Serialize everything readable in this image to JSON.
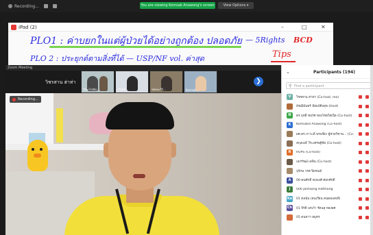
{
  "topbar": {
    "recording_label": "Recording...",
    "share_banner": "You are viewing Komsak Anawong's screen",
    "view_options": "View Options ▾"
  },
  "shared_window": {
    "title": "iPad (2)",
    "handwriting": {
      "line1": "PLO1 : ค่าบยกในแต่ผู้ป่วยได้อย่างถูกต้อง ปลอดภัย",
      "line1_right": "— 5Rights",
      "bcd": "BCD",
      "line2": "PLO 2 : ประยุกต์ตามสิ่งที่ได้ — USP/NF vol. ค่าสุด",
      "tips": "Tips"
    }
  },
  "meeting": {
    "window_title": "Zoom Meeting",
    "self_name": "วิชรสาน ฮ่าท่า",
    "thumbnails": [
      {
        "name": "วิรัฒโรจนิย"
      },
      {
        "name": "ปวีณ์ณี..."
      },
      {
        "name": "ชลธนะวีร์..."
      },
      {
        "name": "Komsak..."
      }
    ],
    "video_recording_label": "Recording..."
  },
  "participants": {
    "title": "Participants (194)",
    "search_placeholder": "Find a participant",
    "list": [
      {
        "initial": "V",
        "name": "วิชรสาน ฮ่าท่า (Co-host, me)",
        "color": "#6fb2a7"
      },
      {
        "initial": "",
        "name": "มัชฌิมันทร์ ลีสมบัติงสุข (Host)",
        "color": "#b06b3a"
      },
      {
        "initial": "N",
        "name": "ดร.ฤทธิ์ ชมรศ ทองไชยใส่เนื้อ (Co-host)",
        "color": "#3ea84a"
      },
      {
        "initial": "K",
        "name": "Komsakd Anawong (Co-host)",
        "color": "#2c6ed1"
      },
      {
        "initial": "",
        "name": "ผศ.ดร.ภาวะดี พรนชีเก ผู้ช่วยวิชาพ... (Co-host)",
        "color": "#9a7b58"
      },
      {
        "initial": "",
        "name": "สกุลเมธี วีระเศรษฐ์ชัย (Co-host)",
        "color": "#8a6e56"
      },
      {
        "initial": "R",
        "name": "RUPS (Co-host)",
        "color": "#e06f2a"
      },
      {
        "initial": "",
        "name": "เอกรัชฒ์ เดลิน (Co-host)",
        "color": "#6a5a48"
      },
      {
        "initial": "",
        "name": "ปุรักษ วรศ ปิยรณย์",
        "color": "#a58a6b"
      },
      {
        "initial": "A",
        "name": "06-ดนศักดิ์ ตบพงศ์ ศยกศักดิ์",
        "color": "#3a4f9c"
      },
      {
        "initial": "J",
        "name": "006 Jantaang Hotthong",
        "color": "#3c7d3e"
      },
      {
        "initial": "Ke",
        "name": "01 ดลฉัน (ดนเรียน คนตอเลขที่)",
        "color": "#4aa8c8"
      },
      {
        "initial": "Ch",
        "name": "01 จีรดิ นรเก้า รัตนสุ ทองยศ",
        "color": "#5a4f9c"
      },
      {
        "initial": "",
        "name": "05 ดนทาฯ สมุทร",
        "color": "#d36b3a"
      }
    ]
  }
}
